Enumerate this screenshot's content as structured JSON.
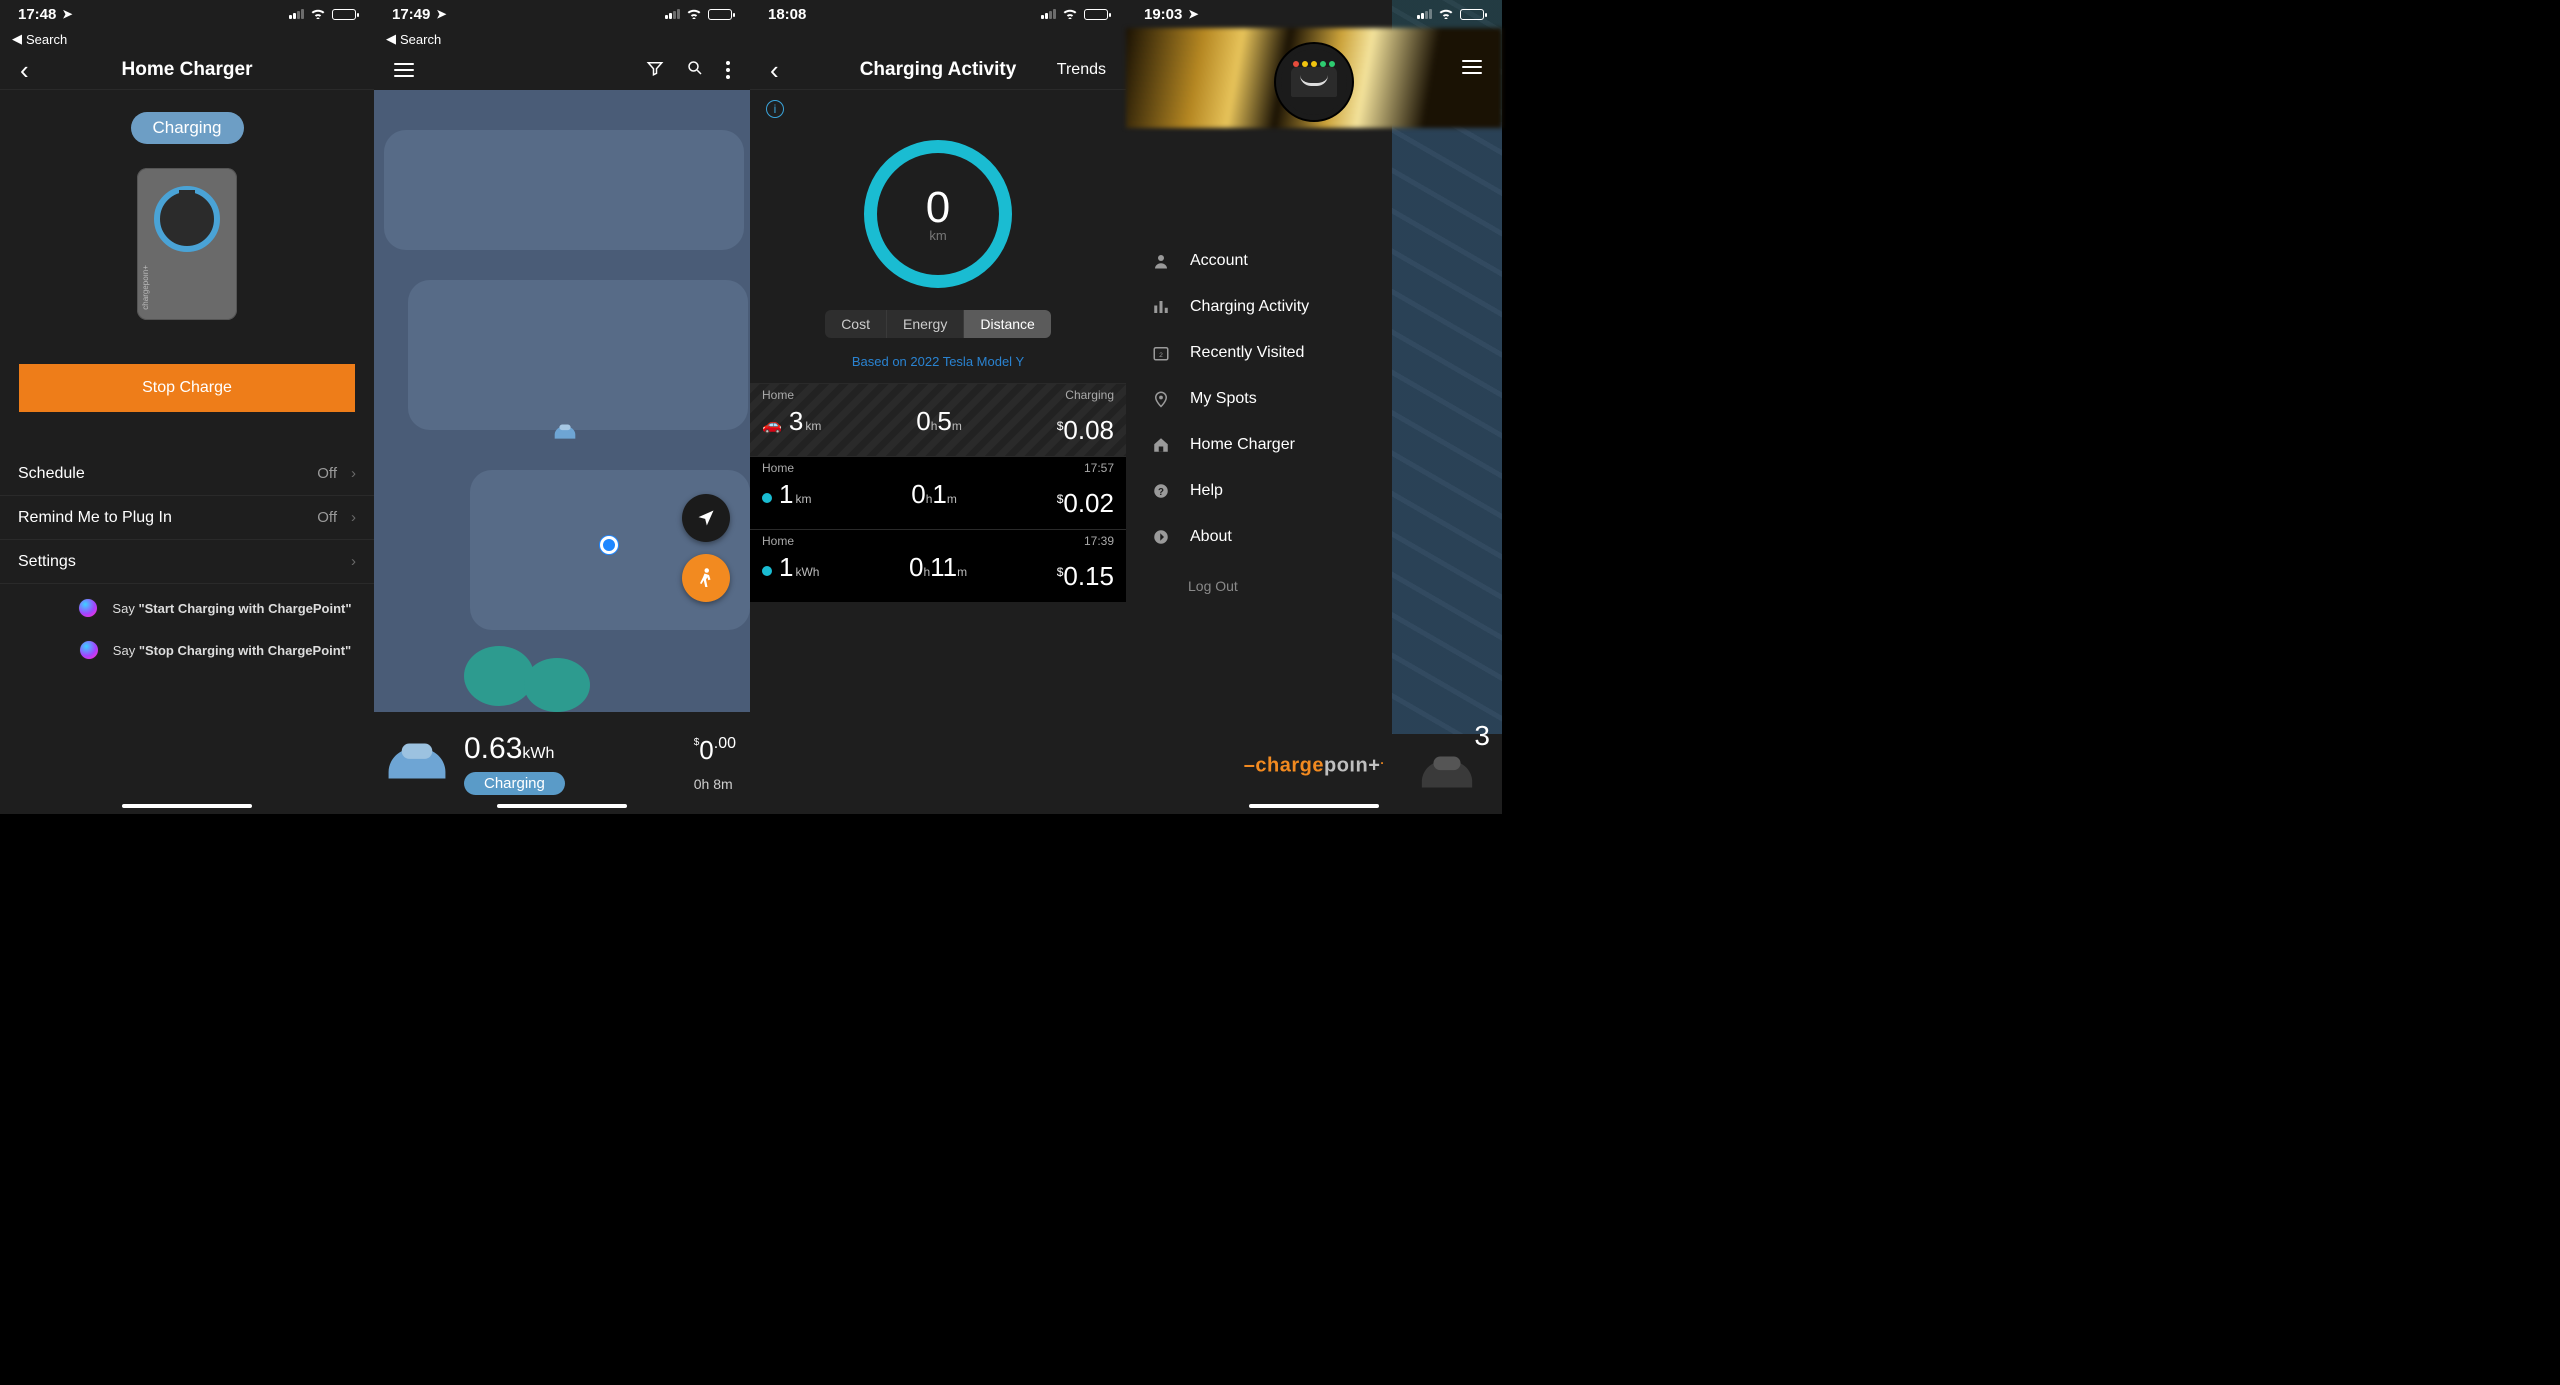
{
  "s1": {
    "time": "17:48",
    "backLinkLabel": "Search",
    "title": "Home Charger",
    "statusPill": "Charging",
    "stopBtn": "Stop Charge",
    "rows": [
      {
        "label": "Schedule",
        "value": "Off",
        "chev": true
      },
      {
        "label": "Remind Me to Plug In",
        "value": "Off",
        "chev": true
      },
      {
        "label": "Settings",
        "value": "",
        "chev": true
      }
    ],
    "siri": [
      {
        "prefix": "Say ",
        "cmd": "\"Start Charging with ChargePoint\""
      },
      {
        "prefix": "Say ",
        "cmd": "\"Stop Charging with ChargePoint\""
      }
    ]
  },
  "s2": {
    "time": "17:49",
    "backLinkLabel": "Search",
    "footer": {
      "kwh_value": "0.63",
      "kwh_unit": "kWh",
      "cost_currency": "$",
      "cost_int": "0",
      "cost_dec": ".00",
      "status": "Charging",
      "dur_h": "0",
      "dur_h_u": "h ",
      "dur_m": "8",
      "dur_m_u": "m"
    }
  },
  "s3": {
    "time": "18:08",
    "title": "Charging Activity",
    "trends": "Trends",
    "gauge": {
      "value": "0",
      "unit": "km"
    },
    "segments": [
      "Cost",
      "Energy",
      "Distance"
    ],
    "basedOn": "Based on 2022 Tesla Model Y",
    "rows": [
      {
        "loc": "Home",
        "right": "Charging",
        "hatch": true,
        "icon": "car",
        "d": "3",
        "du": "km",
        "h": "0",
        "m": "5",
        "cost": "0.08"
      },
      {
        "loc": "Home",
        "right": "17:57",
        "hatch": false,
        "icon": "dot",
        "d": "1",
        "du": "km",
        "h": "0",
        "m": "1",
        "cost": "0.02"
      },
      {
        "loc": "Home",
        "right": "17:39",
        "hatch": false,
        "icon": "dot",
        "d": "1",
        "du": "kWh",
        "h": "0",
        "m": "11",
        "cost": "0.15"
      }
    ]
  },
  "s4": {
    "time": "19:03",
    "menu": [
      {
        "icon": "user",
        "label": "Account"
      },
      {
        "icon": "bars",
        "label": "Charging Activity"
      },
      {
        "icon": "calendar",
        "label": "Recently Visited"
      },
      {
        "icon": "pin",
        "label": "My Spots"
      },
      {
        "icon": "house",
        "label": "Home Charger"
      },
      {
        "icon": "help",
        "label": "Help"
      },
      {
        "icon": "about",
        "label": "About"
      }
    ],
    "logout": "Log Out",
    "brand_dash": "–",
    "brand_charge": "charge",
    "brand_point": "poın+",
    "brand_plus": ".",
    "side_num": "3"
  }
}
